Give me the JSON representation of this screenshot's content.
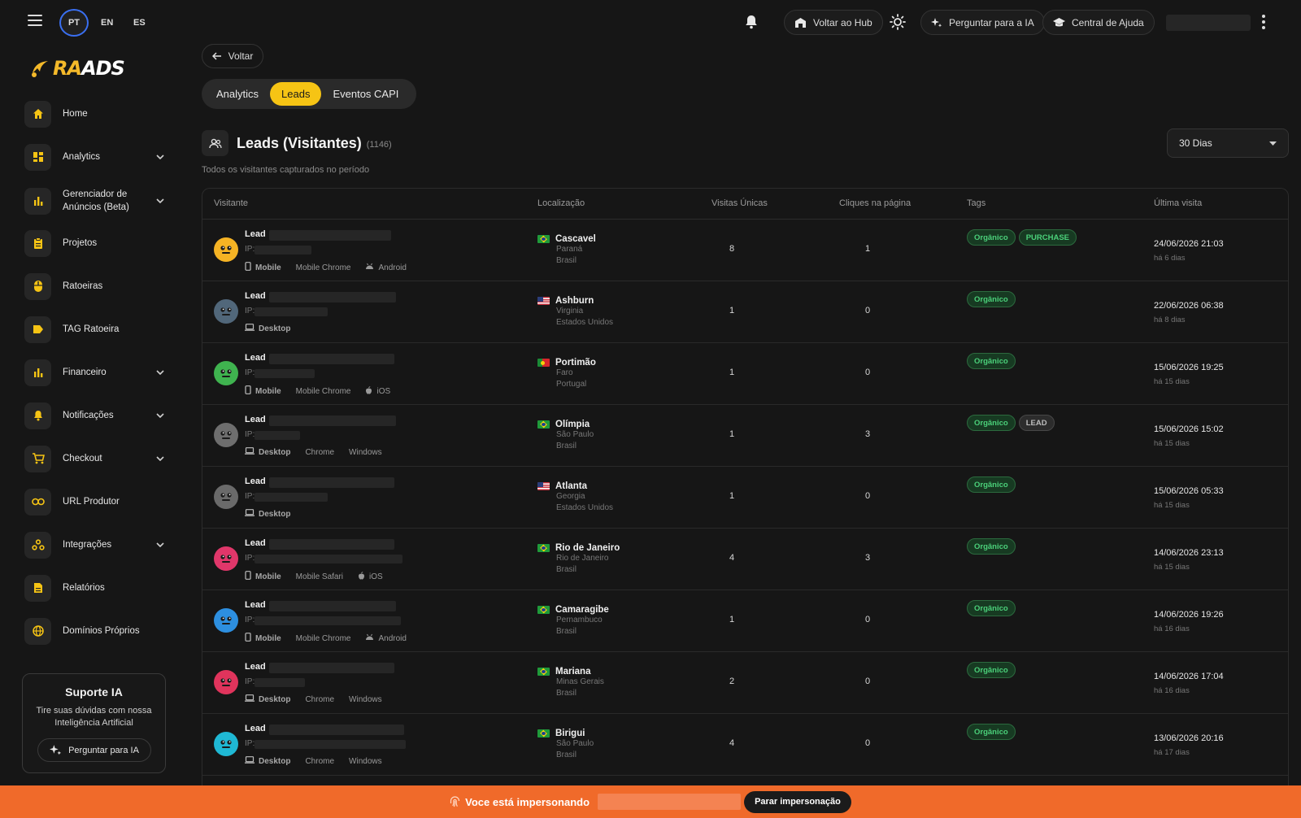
{
  "topbar": {
    "languages": [
      "PT",
      "EN",
      "ES"
    ],
    "active_language": "PT",
    "back_to_hub": "Voltar ao Hub",
    "ask_ai": "Perguntar para a IA",
    "help_center": "Central de Ajuda"
  },
  "brand": {
    "name_part1": "RA",
    "name_part2": "ADS"
  },
  "sidebar": {
    "items": [
      {
        "label": "Home",
        "icon": "home-icon",
        "expandable": false
      },
      {
        "label": "Analytics",
        "icon": "dashboard-icon",
        "expandable": true
      },
      {
        "label": "Gerenciador de Anúncios (Beta)",
        "icon": "bar-chart-icon",
        "expandable": true
      },
      {
        "label": "Projetos",
        "icon": "clipboard-icon",
        "expandable": false
      },
      {
        "label": "Ratoeiras",
        "icon": "mouse-icon",
        "expandable": false
      },
      {
        "label": "TAG Ratoeira",
        "icon": "tag-icon",
        "expandable": false
      },
      {
        "label": "Financeiro",
        "icon": "bar-chart-icon",
        "expandable": true
      },
      {
        "label": "Notificações",
        "icon": "bell-icon",
        "expandable": true
      },
      {
        "label": "Checkout",
        "icon": "cart-icon",
        "expandable": true
      },
      {
        "label": "URL Produtor",
        "icon": "link-icon",
        "expandable": false
      },
      {
        "label": "Integrações",
        "icon": "webhook-icon",
        "expandable": true
      },
      {
        "label": "Relatórios",
        "icon": "document-icon",
        "expandable": false
      },
      {
        "label": "Domínios Próprios",
        "icon": "globe-icon",
        "expandable": false
      }
    ],
    "support": {
      "title": "Suporte IA",
      "text": "Tire suas dúvidas com nossa Inteligência Artificial",
      "button": "Perguntar para IA"
    }
  },
  "page": {
    "back_label": "Voltar",
    "tabs": [
      "Analytics",
      "Leads",
      "Eventos CAPI"
    ],
    "active_tab": "Leads",
    "title": "Leads (Visitantes)",
    "count": "(1146)",
    "subtitle": "Todos os visitantes capturados no período",
    "range": "30 Dias"
  },
  "table": {
    "headers": [
      "Visitante",
      "Localização",
      "Visitas Únicas",
      "Cliques na página",
      "Tags",
      "Última visita"
    ],
    "lead_label": "Lead",
    "ip_label": "IP:",
    "rows": [
      {
        "avatar_color": "#f5b324",
        "device": "Mobile",
        "browser": "Mobile Chrome",
        "os": "Android",
        "os_icon": "android-icon",
        "flag": "BR",
        "city": "Cascavel",
        "region": "Paraná",
        "country": "Brasil",
        "visits": "8",
        "clicks": "1",
        "tags": [
          {
            "text": "Orgânico",
            "style": "green"
          },
          {
            "text": "PURCHASE",
            "style": "green"
          }
        ],
        "date": "24/06/2026 21:03",
        "ago": "há 6 dias"
      },
      {
        "avatar_color": "#51677a",
        "device": "Desktop",
        "browser": "",
        "os": "",
        "os_icon": "",
        "flag": "US",
        "city": "Ashburn",
        "region": "Virginia",
        "country": "Estados Unidos",
        "visits": "1",
        "clicks": "0",
        "tags": [
          {
            "text": "Orgânico",
            "style": "green"
          }
        ],
        "date": "22/06/2026 06:38",
        "ago": "há 8 dias"
      },
      {
        "avatar_color": "#3fb34f",
        "device": "Mobile",
        "browser": "Mobile Chrome",
        "os": "iOS",
        "os_icon": "apple-icon",
        "flag": "PT",
        "city": "Portimão",
        "region": "Faro",
        "country": "Portugal",
        "visits": "1",
        "clicks": "0",
        "tags": [
          {
            "text": "Orgânico",
            "style": "green"
          }
        ],
        "date": "15/06/2026 19:25",
        "ago": "há 15 dias"
      },
      {
        "avatar_color": "#6e6e6e",
        "device": "Desktop",
        "browser": "Chrome",
        "os": "Windows",
        "os_icon": "",
        "flag": "BR",
        "city": "Olímpia",
        "region": "São Paulo",
        "country": "Brasil",
        "visits": "1",
        "clicks": "3",
        "tags": [
          {
            "text": "Orgânico",
            "style": "green"
          },
          {
            "text": "LEAD",
            "style": "gray"
          }
        ],
        "date": "15/06/2026 15:02",
        "ago": "há 15 dias"
      },
      {
        "avatar_color": "#6a6a6a",
        "device": "Desktop",
        "browser": "",
        "os": "",
        "os_icon": "",
        "flag": "US",
        "city": "Atlanta",
        "region": "Georgia",
        "country": "Estados Unidos",
        "visits": "1",
        "clicks": "0",
        "tags": [
          {
            "text": "Orgânico",
            "style": "green"
          }
        ],
        "date": "15/06/2026 05:33",
        "ago": "há 15 dias"
      },
      {
        "avatar_color": "#e0376a",
        "device": "Mobile",
        "browser": "Mobile Safari",
        "os": "iOS",
        "os_icon": "apple-icon",
        "flag": "BR",
        "city": "Rio de Janeiro",
        "region": "Rio de Janeiro",
        "country": "Brasil",
        "visits": "4",
        "clicks": "3",
        "tags": [
          {
            "text": "Orgânico",
            "style": "green"
          }
        ],
        "date": "14/06/2026 23:13",
        "ago": "há 15 dias"
      },
      {
        "avatar_color": "#2d8fe0",
        "device": "Mobile",
        "browser": "Mobile Chrome",
        "os": "Android",
        "os_icon": "android-icon",
        "flag": "BR",
        "city": "Camaragibe",
        "region": "Pernambuco",
        "country": "Brasil",
        "visits": "1",
        "clicks": "0",
        "tags": [
          {
            "text": "Orgânico",
            "style": "green"
          }
        ],
        "date": "14/06/2026 19:26",
        "ago": "há 16 dias"
      },
      {
        "avatar_color": "#e0345c",
        "device": "Desktop",
        "browser": "Chrome",
        "os": "Windows",
        "os_icon": "",
        "flag": "BR",
        "city": "Mariana",
        "region": "Minas Gerais",
        "country": "Brasil",
        "visits": "2",
        "clicks": "0",
        "tags": [
          {
            "text": "Orgânico",
            "style": "green"
          }
        ],
        "date": "14/06/2026 17:04",
        "ago": "há 16 dias"
      },
      {
        "avatar_color": "#1fb8d4",
        "device": "Desktop",
        "browser": "Chrome",
        "os": "Windows",
        "os_icon": "",
        "flag": "BR",
        "city": "Birigui",
        "region": "São Paulo",
        "country": "Brasil",
        "visits": "4",
        "clicks": "0",
        "tags": [
          {
            "text": "Orgânico",
            "style": "green"
          }
        ],
        "date": "13/06/2026 20:16",
        "ago": "há 17 dias"
      }
    ]
  },
  "impersonation": {
    "text": "Voce está impersonando",
    "button": "Parar impersonação"
  },
  "colors": {
    "accent": "#f6c414",
    "background": "#161616",
    "banner": "#f06a2a",
    "tag_green": "#4bd07a"
  }
}
